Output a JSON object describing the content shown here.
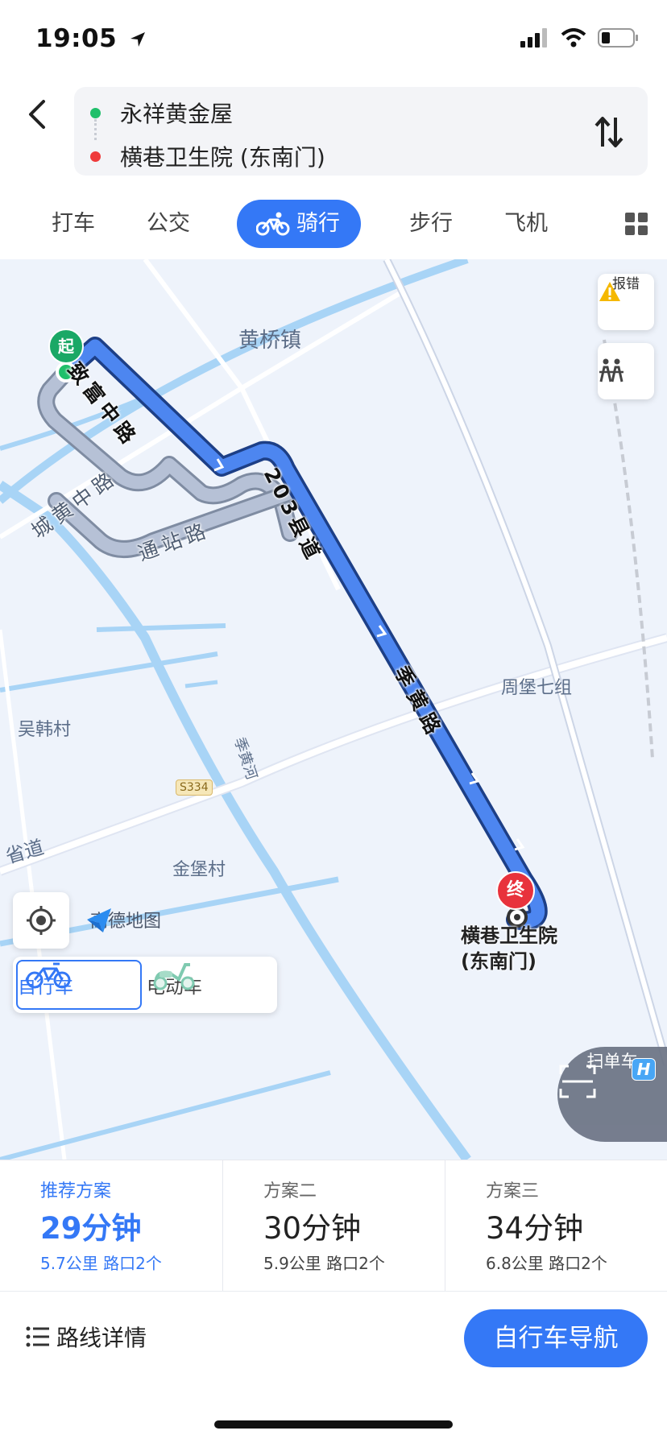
{
  "status_bar": {
    "time": "19:05"
  },
  "route": {
    "start": "永祥黄金屋",
    "end": "横巷卫生院 (东南门)",
    "start_color": "#1fbf6a",
    "end_color": "#ef3b3b"
  },
  "tabs": [
    "打车",
    "公交",
    "骑行",
    "步行",
    "飞机"
  ],
  "active_tab": "骑行",
  "map": {
    "places": {
      "town": "黄桥镇",
      "group": "周堡七组",
      "village1": "吴韩村",
      "village2": "金堡村"
    },
    "river": "季黄河",
    "highway_badge": "S334",
    "province_road": "省道",
    "roads": {
      "r1": "致富中路",
      "r2": "203县道",
      "r3": "季黄路",
      "alt1": "城黄中路",
      "alt2": "通站路"
    },
    "start_pin": "起",
    "end_pin": "终",
    "destination_line1": "横巷卫生院",
    "destination_line2": "(东南门)",
    "report_button": "报错",
    "logo_text": "高德地图",
    "scan_label": "扫单车",
    "vehicles": {
      "bike": "自行车",
      "ebike": "电动车"
    },
    "route_color": "#3478f6"
  },
  "plans": [
    {
      "title": "推荐方案",
      "time": "29分钟",
      "meta": "5.7公里  路口2个"
    },
    {
      "title": "方案二",
      "time": "30分钟",
      "meta": "5.9公里  路口2个"
    },
    {
      "title": "方案三",
      "time": "34分钟",
      "meta": "6.8公里  路口2个"
    }
  ],
  "bottom": {
    "details": "路线详情",
    "navigate": "自行车导航"
  },
  "accent_color": "#3478f6"
}
